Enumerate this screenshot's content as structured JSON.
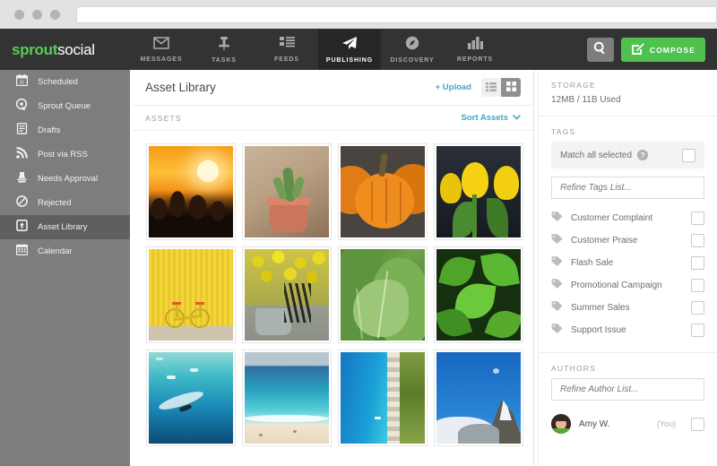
{
  "browser": {
    "address_value": "",
    "traffic_lights": [
      "close-dot",
      "minimize-dot",
      "maximize-dot"
    ]
  },
  "topnav": {
    "logo_primary": "sprout",
    "logo_secondary": "social",
    "items": [
      {
        "label": "MESSAGES",
        "icon": "envelope-icon",
        "active": false
      },
      {
        "label": "TASKS",
        "icon": "pushpin-icon",
        "active": false
      },
      {
        "label": "FEEDS",
        "icon": "list-icon",
        "active": false
      },
      {
        "label": "PUBLISHING",
        "icon": "paper-plane-icon",
        "active": true
      },
      {
        "label": "DISCOVERY",
        "icon": "compass-icon",
        "active": false
      },
      {
        "label": "REPORTS",
        "icon": "bar-chart-icon",
        "active": false
      }
    ],
    "search_icon": "search-icon",
    "compose_label": "COMPOSE",
    "compose_icon": "compose-pencil-icon",
    "accent_green": "#4ec14e",
    "bar_color": "#333333"
  },
  "sidebar": {
    "items": [
      {
        "label": "Scheduled",
        "icon": "calendar-date-icon",
        "active": false
      },
      {
        "label": "Sprout Queue",
        "icon": "sprout-queue-icon",
        "active": false
      },
      {
        "label": "Drafts",
        "icon": "document-icon",
        "active": false
      },
      {
        "label": "Post via RSS",
        "icon": "rss-icon",
        "active": false
      },
      {
        "label": "Needs Approval",
        "icon": "stamp-icon",
        "active": false
      },
      {
        "label": "Rejected",
        "icon": "circle-slash-icon",
        "active": false
      },
      {
        "label": "Asset Library",
        "icon": "upload-box-icon",
        "active": true
      },
      {
        "label": "Calendar",
        "icon": "calendar-grid-icon",
        "active": false
      }
    ]
  },
  "main": {
    "page_title": "Asset Library",
    "upload_label": "+ Upload",
    "view_list_icon": "list-view-icon",
    "view_grid_icon": "grid-view-icon",
    "active_view": "grid",
    "assets_label": "ASSETS",
    "sort_label": "Sort Assets",
    "sort_icon": "chevron-down-icon",
    "link_color": "#3fa8c4",
    "assets": [
      {
        "name": "sunset-over-mountains"
      },
      {
        "name": "cactus-in-terracotta-pot"
      },
      {
        "name": "orange-pumpkins"
      },
      {
        "name": "yellow-tulips-dark-background"
      },
      {
        "name": "bicycle-against-yellow-wall"
      },
      {
        "name": "yellow-flowers-in-bucket"
      },
      {
        "name": "green-chard-leaves"
      },
      {
        "name": "green-maple-leaves"
      },
      {
        "name": "surfers-in-turquoise-ocean"
      },
      {
        "name": "beach-with-blue-water"
      },
      {
        "name": "aerial-coastline-blue-water"
      },
      {
        "name": "snow-capped-mountain-peak"
      }
    ]
  },
  "right": {
    "storage_title": "STORAGE",
    "storage_value": "12MB / 11B Used",
    "tags_title": "TAGS",
    "match_label": "Match all selected",
    "match_help_icon": "help-circle-icon",
    "match_checked": false,
    "tags_placeholder": "Refine Tags List...",
    "tags_input_value": "",
    "tags": [
      {
        "label": "Customer Complaint",
        "icon": "tag-icon",
        "checked": false
      },
      {
        "label": "Customer Praise",
        "icon": "tag-icon",
        "checked": false
      },
      {
        "label": "Flash Sale",
        "icon": "tag-icon",
        "checked": false
      },
      {
        "label": "Promotional Campaign",
        "icon": "tag-icon",
        "checked": false
      },
      {
        "label": "Summer Sales",
        "icon": "tag-icon",
        "checked": false
      },
      {
        "label": "Support Issue",
        "icon": "tag-icon",
        "checked": false
      }
    ],
    "authors_title": "AUTHORS",
    "authors_placeholder": "Refine Author List...",
    "authors_input_value": "",
    "authors": [
      {
        "name": "Amy W.",
        "badge": "(You)",
        "avatar": "user-avatar",
        "checked": false
      }
    ]
  }
}
